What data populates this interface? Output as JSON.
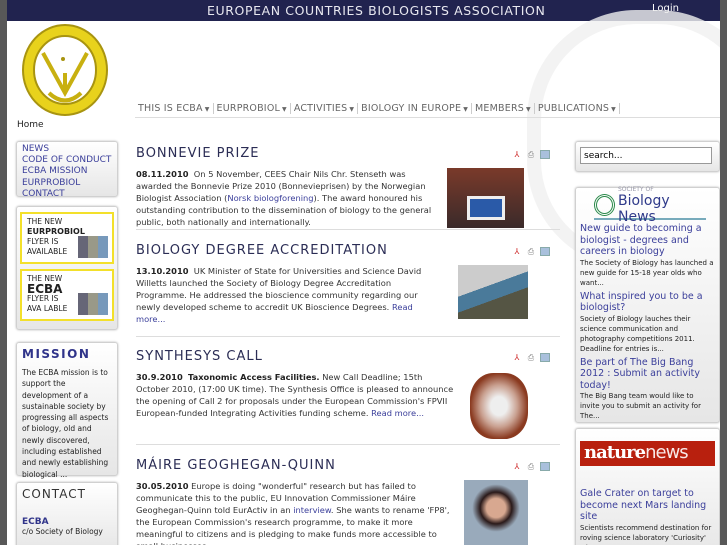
{
  "header": {
    "title": "EUROPEAN COUNTRIES BIOLOGISTS ASSOCIATION",
    "login": "Login",
    "logo_text": "EUROPEAN COUNTRIES BIOLOGISTS ASSOCIATION"
  },
  "nav": [
    "THIS IS ECBA",
    "EURPROBIOL",
    "ACTIVITIES",
    "BIOLOGY IN EUROPE",
    "MEMBERS",
    "PUBLICATIONS"
  ],
  "breadcrumb": "Home",
  "sidebar": {
    "menu": [
      "NEWS",
      "CODE OF CONDUCT",
      "ECBA MISSION",
      "EURPROBIOL",
      "CONTACT"
    ],
    "flyers": [
      {
        "l1": "THE NEW",
        "l2": "EURPROBIOL",
        "l3": "FLYER IS",
        "l4": "AVAILABLE"
      },
      {
        "l1": "THE NEW",
        "l2": "ECBA",
        "l3": "FLYER IS",
        "l4": "AVA LABLE"
      }
    ],
    "mission_title": "MISSION",
    "mission_text": "The ECBA mission is to support the development of a sustainable society by progressing all aspects of biology, old and newly discovered, including established and newly establishing biological ...",
    "contact_title": "CONTACT",
    "contact_org": "ECBA",
    "contact_line": "c/o Society of Biology"
  },
  "articles": [
    {
      "title": "BONNEVIE PRIZE",
      "date": "08.11.2010",
      "text1": "On 5 November, CEES Chair Nils Chr. Stenseth was awarded the Bonnevie Prize 2010 (Bonnevieprisen) by the Norwegian Biologist Association (",
      "link": "Norsk biologforening",
      "text2": "). The award honoured his outstanding contribution to the dissemination of biology to the general public, both nationally and internationally."
    },
    {
      "title": "BIOLOGY DEGREE ACCREDITATION",
      "date": "13.10.2010",
      "text1": "UK Minister of State for Universities and Science David Willetts launched the Society of Biology Degree Accreditation Programme. He addressed the bioscience community regarding our newly developed scheme to accredit UK Bioscience Degrees. ",
      "link": "Read more..."
    },
    {
      "title": "SYNTHESYS CALL",
      "date": "30.9.2010",
      "bold": "Taxonomic Access Facilities.",
      "text1": " New Call Deadline; 15th October 2010, (17:00 UK time). The Synthesis Office is pleased to announce the opening of Call 2 for proposals under the European Commission's FPVII European-funded Integrating Activities funding scheme. ",
      "link": "Read more..."
    },
    {
      "title": "MÁIRE GEOGHEGAN-QUINN",
      "date": "30.05.2010",
      "text1": "Europe is doing \"wonderful\" research but has failed to communicate this to the public, EU Innovation Commissioner Máire Geoghegan-Quinn told EurActiv in an ",
      "link": "interview",
      "text2": ". She wants to rename 'FP8', the European Commission's research programme, to make it more meaningful to citizens and is pledging to make funds more accessible to small businesses."
    }
  ],
  "search": {
    "placeholder": "search..."
  },
  "society_news": {
    "logo": "Biology News",
    "logo_small": "SOCIETY OF",
    "items": [
      {
        "title": "New guide to becoming a biologist - degrees and careers in biology",
        "summary": "The Society of Biology has launched a new guide for 15-18 year olds who want..."
      },
      {
        "title": "What inspired you to be a biologist?",
        "summary": "Society of Biology lauches their science communication and photography competitions 2011. Deadline for entries is..."
      },
      {
        "title": "Be part of The Big Bang 2012 : Submit an activity today!",
        "summary": "The Big Bang team would like to invite you to submit an activity for The..."
      }
    ]
  },
  "nature_news": {
    "logo_a": "nature",
    "logo_b": "news",
    "items": [
      {
        "title": "Gale Crater on target to become next Mars landing site",
        "summary": "Scientists recommend destination for roving science laboratory 'Curiosity' <img"
      }
    ]
  }
}
